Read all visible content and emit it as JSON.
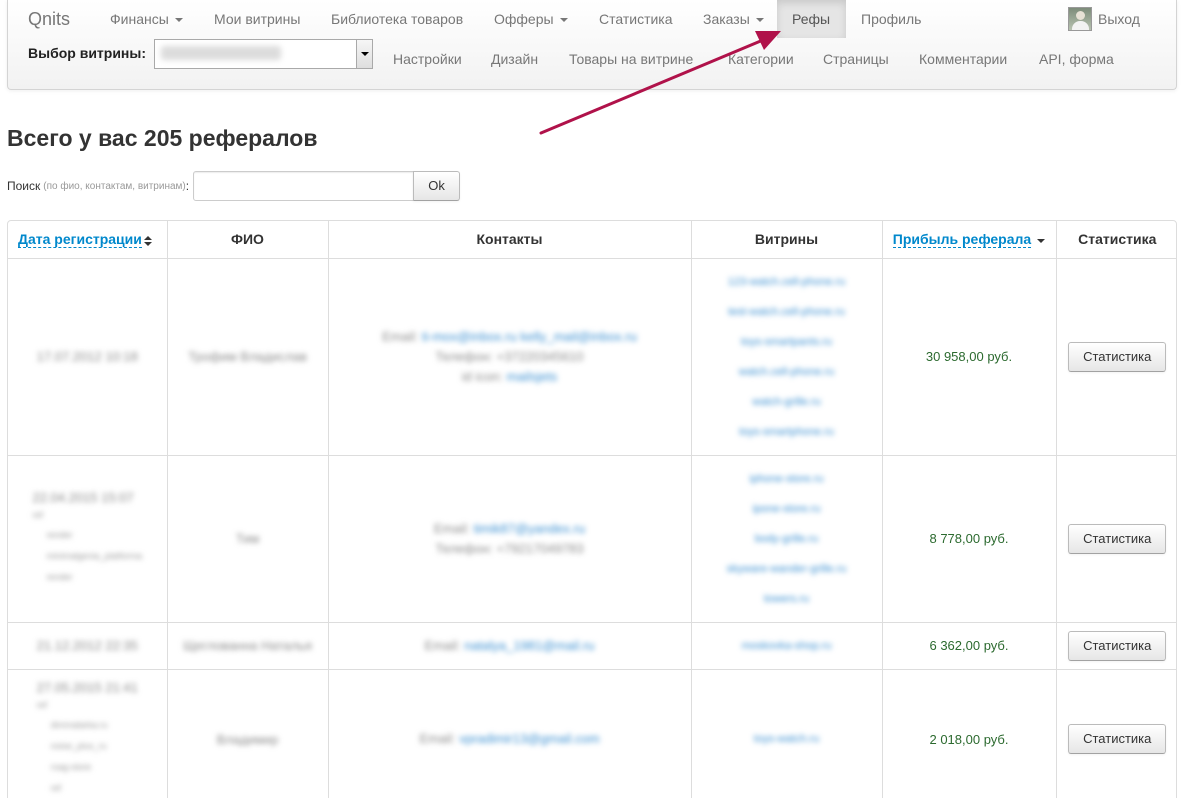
{
  "navbar": {
    "brand": "Qnits",
    "items": [
      {
        "label": "Финансы",
        "dropdown": true
      },
      {
        "label": "Мои витрины",
        "dropdown": false
      },
      {
        "label": "Библиотека товаров",
        "dropdown": false
      },
      {
        "label": "Офферы",
        "dropdown": true
      },
      {
        "label": "Статистика",
        "dropdown": false
      },
      {
        "label": "Заказы",
        "dropdown": true
      },
      {
        "label": "Рефы",
        "dropdown": false,
        "active": true
      },
      {
        "label": "Профиль",
        "dropdown": false
      }
    ],
    "exit_label": "Выход",
    "vitrina_label": "Выбор витрины:",
    "vitrina_selected": "redacted",
    "sub_items": [
      "Настройки",
      "Дизайн",
      "Товары на витрине",
      "Категории",
      "Страницы",
      "Комментарии",
      "API, форма"
    ]
  },
  "page": {
    "title": "Всего у вас 205 рефералов",
    "search_label": "Поиск",
    "search_hint": "(по фио, контактам, витринам)",
    "search_colon": ":",
    "search_value": "",
    "search_button": "Ok"
  },
  "table": {
    "headers": {
      "date": "Дата регистрации",
      "name": "ФИО",
      "contacts": "Контакты",
      "shops": "Витрины",
      "profit": "Прибыль реферала",
      "stats": "Статистика"
    },
    "rows": [
      {
        "date": "17.07.2012 10:18",
        "sub_head": "",
        "sub_items": [],
        "name": "Трофим Владислав",
        "email_label": "Email:",
        "email": "ti-mox@inbox.ru kelly_mail@inbox.ru",
        "phone_label": "Телефон:",
        "phone": "+37220345610",
        "icq_label": "id icon:",
        "icq": "mailsjets",
        "shops": [
          "123-watch.cell-phone.ru",
          "test-watch.cell-phone.ru",
          "toys-smartpants.ru",
          "watch.cell-phone.ru",
          "watch-grille.ru",
          "toys-smartphone.ru"
        ],
        "profit": "30 958,00 руб.",
        "stats_button": "Статистика"
      },
      {
        "date": "22.04.2015 15:07",
        "sub_head": "ref",
        "sub_items": [
          "render",
          "minimalgenia_platforma",
          "render"
        ],
        "name": "Тим",
        "email_label": "Email:",
        "email": "timik87@yandex.ru",
        "phone_label": "Телефон:",
        "phone": "+79217049783",
        "icq_label": "",
        "icq": "",
        "shops": [
          "iphone-store.ru",
          "ipone-store.ru",
          "body-grille.ru",
          "skyware-wander-grille.ru",
          "towers.ru"
        ],
        "profit": "8 778,00 руб.",
        "stats_button": "Статистика"
      },
      {
        "date": "21.12.2012 22:35",
        "sub_head": "",
        "sub_items": [],
        "name": "Щеглованна Наталья",
        "email_label": "Email:",
        "email": "natalya_1981@mail.ru",
        "phone_label": "",
        "phone": "",
        "icq_label": "",
        "icq": "",
        "shops": [
          "moskovka-shop.ru"
        ],
        "profit": "6 362,00 руб.",
        "stats_button": "Статистика"
      },
      {
        "date": "27.05.2015 21:41",
        "sub_head": "ref",
        "sub_items": [
          "dimmalarka.ru",
          "noise_plus_ru",
          "rsag-store",
          "ref"
        ],
        "name": "Владимир",
        "email_label": "Email:",
        "email": "vpradimir13@gmail.com",
        "phone_label": "",
        "phone": "",
        "icq_label": "",
        "icq": "",
        "shops": [
          "toys-watch.ru"
        ],
        "profit": "2 018,00 руб.",
        "stats_button": "Статистика"
      }
    ]
  },
  "colors": {
    "link": "#0088cc",
    "profit": "#2c6a2f",
    "annotation_arrow": "#b0124a"
  }
}
